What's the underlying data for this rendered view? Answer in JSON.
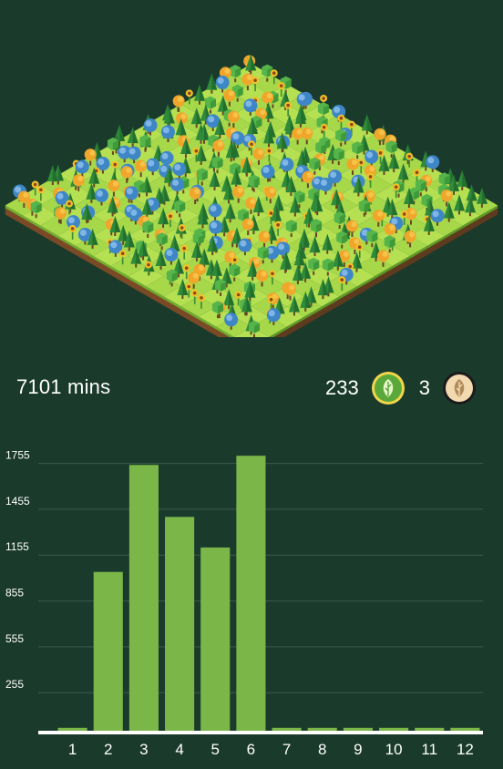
{
  "stats": {
    "total_time": "7101 mins",
    "healthy_count": "233",
    "withered_count": "3",
    "healthy_icon": "green-leaf-icon",
    "withered_icon": "withered-leaf-icon"
  },
  "colors": {
    "background": "#1a3a2c",
    "bar": "#7ab648",
    "gridline": "#3d5a4c",
    "baseline": "#ffffff"
  },
  "chart_data": {
    "type": "bar",
    "categories": [
      "1",
      "2",
      "3",
      "4",
      "5",
      "6",
      "7",
      "8",
      "9",
      "10",
      "11",
      "12"
    ],
    "values": [
      25,
      1045,
      1745,
      1405,
      1205,
      1805,
      25,
      25,
      25,
      25,
      25,
      25
    ],
    "yticks": [
      255,
      555,
      855,
      1155,
      1455,
      1755
    ],
    "ylim": [
      0,
      1830
    ],
    "grid": true,
    "title": "",
    "xlabel": "",
    "ylabel": ""
  }
}
